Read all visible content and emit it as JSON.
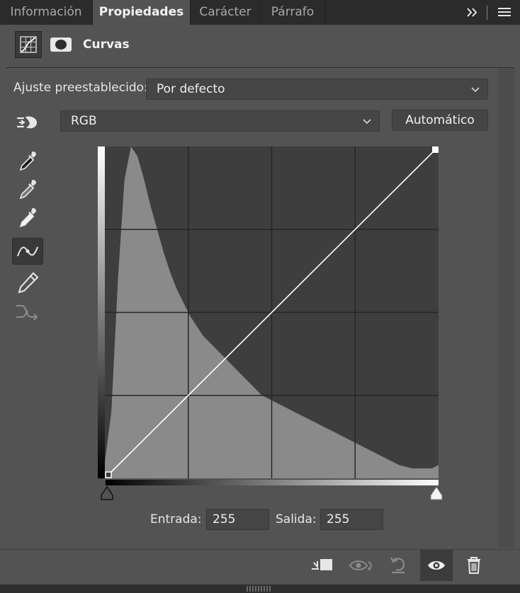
{
  "tabs": [
    {
      "label": "Información",
      "active": false
    },
    {
      "label": "Propiedades",
      "active": true
    },
    {
      "label": "Carácter",
      "active": false
    },
    {
      "label": "Párrafo",
      "active": false
    }
  ],
  "tabbar": {
    "overflow_icon": "double-chevron-right-icon",
    "menu_icon": "hamburger-menu-icon"
  },
  "header": {
    "title": "Curvas",
    "adjustment_icon": "curves-adjustment-icon",
    "mask_icon": "layer-mask-icon"
  },
  "preset": {
    "label": "Ajuste preestablecido:",
    "value": "Por defecto"
  },
  "channel": {
    "value": "RGB",
    "auto_label": "Automático",
    "target_icon": "on-image-adjustment-icon"
  },
  "tools": [
    {
      "name": "black-point-eyedropper-icon"
    },
    {
      "name": "gray-point-eyedropper-icon"
    },
    {
      "name": "white-point-eyedropper-icon"
    },
    {
      "name": "curve-points-icon",
      "selected": true
    },
    {
      "name": "pencil-draw-icon"
    },
    {
      "name": "smooth-curve-icon",
      "disabled": true
    }
  ],
  "curve": {
    "points": [
      [
        0,
        0
      ],
      [
        255,
        255
      ]
    ],
    "selected_point": [
      255,
      255
    ],
    "grid_divisions": 4,
    "histogram": [
      0.05,
      0.2,
      0.6,
      0.9,
      1.0,
      0.97,
      0.9,
      0.82,
      0.75,
      0.68,
      0.62,
      0.57,
      0.53,
      0.49,
      0.46,
      0.43,
      0.41,
      0.39,
      0.37,
      0.35,
      0.33,
      0.31,
      0.29,
      0.27,
      0.25,
      0.24,
      0.23,
      0.22,
      0.21,
      0.2,
      0.19,
      0.18,
      0.17,
      0.16,
      0.15,
      0.14,
      0.13,
      0.12,
      0.11,
      0.1,
      0.09,
      0.08,
      0.07,
      0.06,
      0.05,
      0.04,
      0.035,
      0.03,
      0.03,
      0.03,
      0.03,
      0.04
    ]
  },
  "io": {
    "input_label": "Entrada:",
    "input_value": "255",
    "output_label": "Salida:",
    "output_value": "255"
  },
  "footer": {
    "buttons": [
      {
        "name": "clip-to-layer-icon"
      },
      {
        "name": "view-previous-state-icon"
      },
      {
        "name": "reset-adjustment-icon"
      },
      {
        "name": "toggle-visibility-icon",
        "active": true
      },
      {
        "name": "delete-adjustment-icon"
      }
    ]
  }
}
